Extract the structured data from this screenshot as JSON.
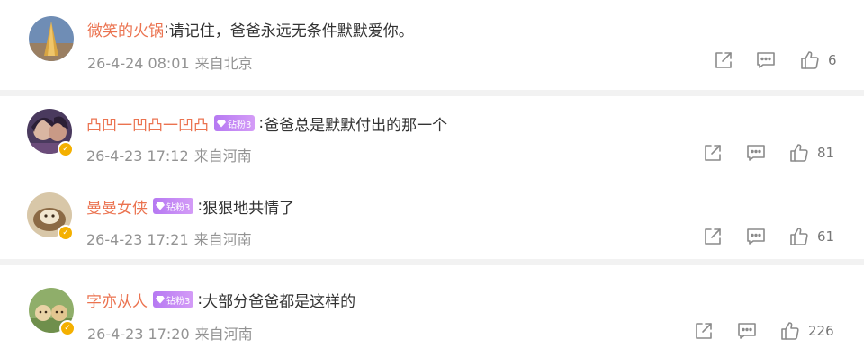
{
  "comments": [
    {
      "username": "微笑的火锅",
      "separator": ":",
      "text": "请记住，爸爸永远无条件默默爱你。",
      "fan_badge": "",
      "date": "26-4-24 08:01",
      "location": "来自北京",
      "likes": "6",
      "verified": false
    },
    {
      "username": "凸凹一凹凸一凹凸",
      "separator": ":",
      "text": "爸爸总是默默付出的那一个",
      "fan_badge": "钻粉3",
      "date": "26-4-23 17:12",
      "location": "来自河南",
      "likes": "81",
      "verified": true
    },
    {
      "username": "曼曼女侠",
      "separator": ":",
      "text": "狠狠地共情了",
      "fan_badge": "钻粉3",
      "date": "26-4-23 17:21",
      "location": "来自河南",
      "likes": "61",
      "verified": true
    },
    {
      "username": "字亦从人",
      "separator": ":",
      "text": "大部分爸爸都是这样的",
      "fan_badge": "钻粉3",
      "date": "26-4-23 17:20",
      "location": "来自河南",
      "likes": "226",
      "verified": true
    }
  ],
  "icons": {
    "share": "share-icon",
    "reply": "comment-icon",
    "like": "thumbs-up-icon",
    "verified": "verified-badge-icon",
    "fan_gem": "diamond-icon"
  },
  "colors": {
    "username": "#eb7350",
    "fan_badge": "#b679f2",
    "meta": "#939393",
    "verified": "#f4b000"
  }
}
